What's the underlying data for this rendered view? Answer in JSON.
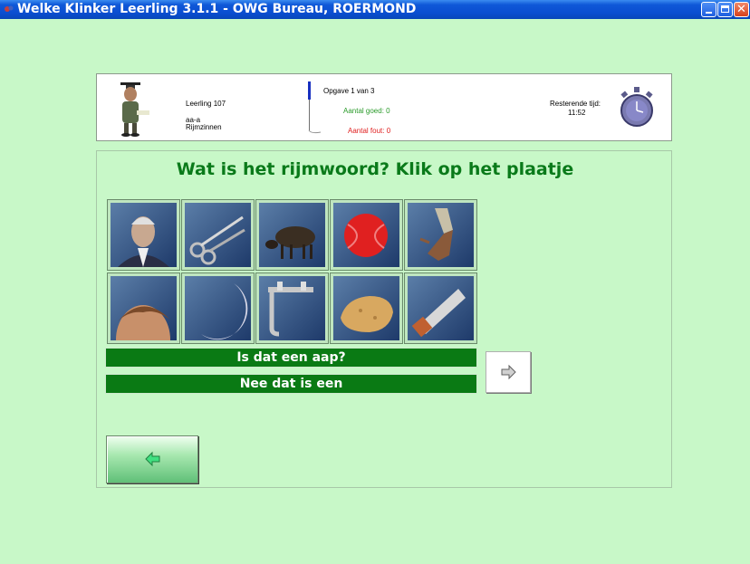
{
  "window": {
    "title": "Welke Klinker Leerling  3.1.1 - OWG Bureau, ROERMOND"
  },
  "header": {
    "student_name": "Leerling 107",
    "student_level": "aa-a",
    "exercise_type": "Rijmzinnen",
    "exercise_progress": "Opgave 1 van 3",
    "correct_count": "Aantal goed: 0",
    "wrong_count": "Aantal fout: 0",
    "time_label": "Resterende tijd:",
    "time_value": "11:52"
  },
  "question": "Wat is het rijmwoord? Klik op het plaatje",
  "tiles_row1": [
    "man",
    "schaar",
    "schaap",
    "bal",
    "hand"
  ],
  "tiles_row2": [
    "haar",
    "maan",
    "kraan",
    "spons",
    "zaag"
  ],
  "feedback": {
    "line1": "Is dat een aap?",
    "line2": "Nee dat is een"
  },
  "colors": {
    "background": "#c8f8c8",
    "accent_green": "#0a7a14",
    "question_green": "#0a7a1a",
    "correct_green": "#2a9a2a",
    "wrong_red": "#e02020"
  },
  "icons": {
    "next": "arrow-right-icon",
    "back": "arrow-left-icon",
    "timer": "stopwatch-icon"
  }
}
